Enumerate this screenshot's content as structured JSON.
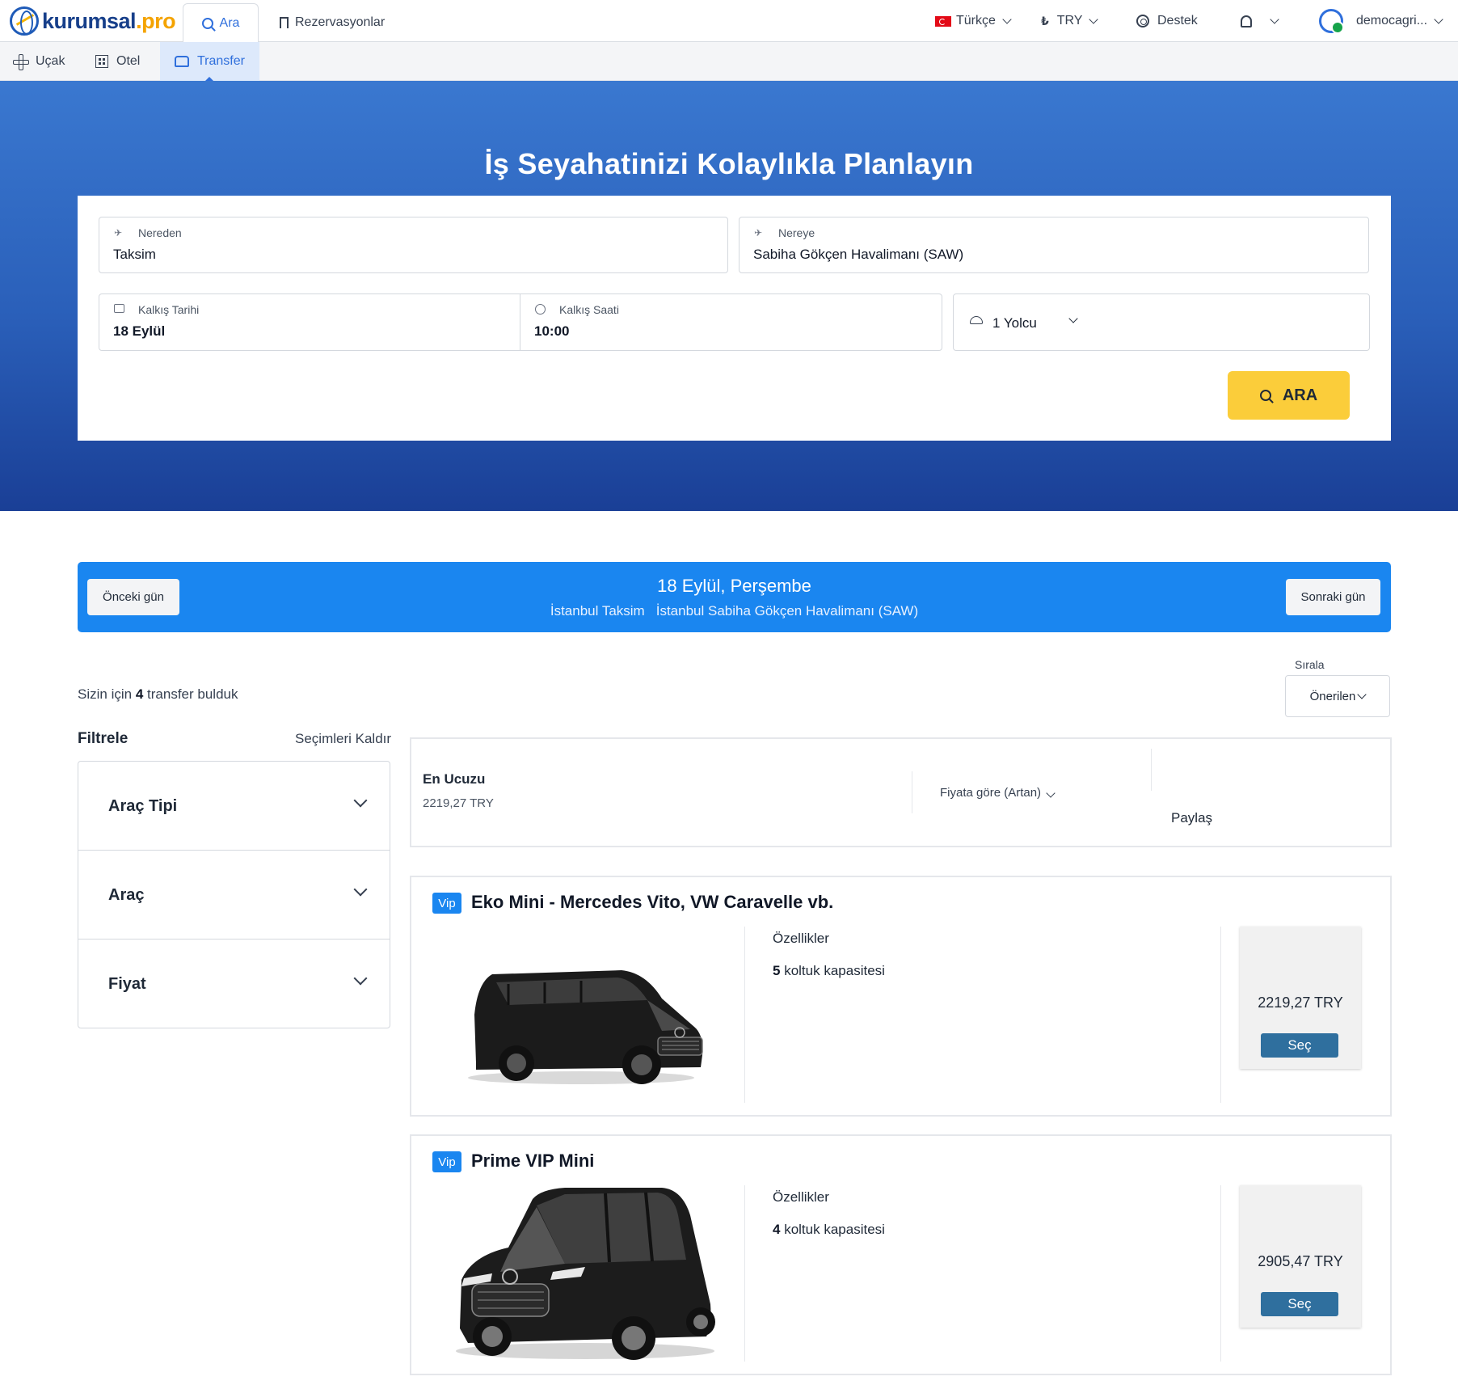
{
  "header": {
    "logo_main": "kurumsal",
    "logo_dot": ".",
    "logo_suffix": "pro",
    "tabs": [
      {
        "label": "Ara",
        "icon": "search-icon"
      },
      {
        "label": "Rezervasyonlar",
        "icon": "bookmark-icon"
      }
    ],
    "language": "Türkçe",
    "currency": "TRY",
    "currency_symbol": "₺",
    "support": "Destek",
    "user": "democagri..."
  },
  "subnav": {
    "items": [
      {
        "label": "Uçak",
        "icon": "plane-icon"
      },
      {
        "label": "Otel",
        "icon": "hotel-icon"
      },
      {
        "label": "Transfer",
        "icon": "car-icon",
        "active": true
      }
    ]
  },
  "hero": {
    "title": "İş Seyahatinizi Kolaylıkla Planlayın"
  },
  "search": {
    "from_label": "Nereden",
    "from_value": "Taksim",
    "to_label": "Nereye",
    "to_value": "Sabiha Gökçen Havalimanı (SAW)",
    "date_label": "Kalkış Tarihi",
    "date_value": "18 Eylül",
    "time_label": "Kalkış Saati",
    "time_value": "10:00",
    "passengers": "1 Yolcu",
    "button": "ARA"
  },
  "daybar": {
    "prev": "Önceki gün",
    "next": "Sonraki gün",
    "date": "18 Eylül, Perşembe",
    "from": "İstanbul Taksim",
    "to": "İstanbul Sabiha Gökçen Havalimanı (SAW)"
  },
  "results": {
    "found_prefix": "Sizin için",
    "found_count": "4",
    "found_suffix": "transfer bulduk",
    "sort_label": "Sırala",
    "sort_value": "Önerilen"
  },
  "filters": {
    "title": "Filtrele",
    "clear": "Seçimleri Kaldır",
    "groups": [
      "Araç Tipi",
      "Araç",
      "Fiyat"
    ]
  },
  "summary": {
    "cheapest_label": "En Ucuzu",
    "cheapest_price": "2219,27 TRY",
    "sort": "Fiyata göre (Artan)",
    "share": "Paylaş"
  },
  "cards": [
    {
      "badge": "Vip",
      "title": "Eko Mini - Mercedes Vito, VW Caravelle vb.",
      "features_label": "Özellikler",
      "seats": "5",
      "seats_text": "koltuk kapasitesi",
      "price": "2219,27 TRY",
      "select": "Seç"
    },
    {
      "badge": "Vip",
      "title": "Prime VIP Mini",
      "features_label": "Özellikler",
      "seats": "4",
      "seats_text": "koltuk kapasitesi",
      "price": "2905,47 TRY",
      "select": "Seç"
    }
  ],
  "colors": {
    "accent": "#2f6fdc",
    "hero_top": "#3a78d0",
    "hero_bottom": "#1a3f96",
    "search_button": "#fbcd3a",
    "daybar": "#1a86f0",
    "select_button": "#2f6f9e"
  }
}
